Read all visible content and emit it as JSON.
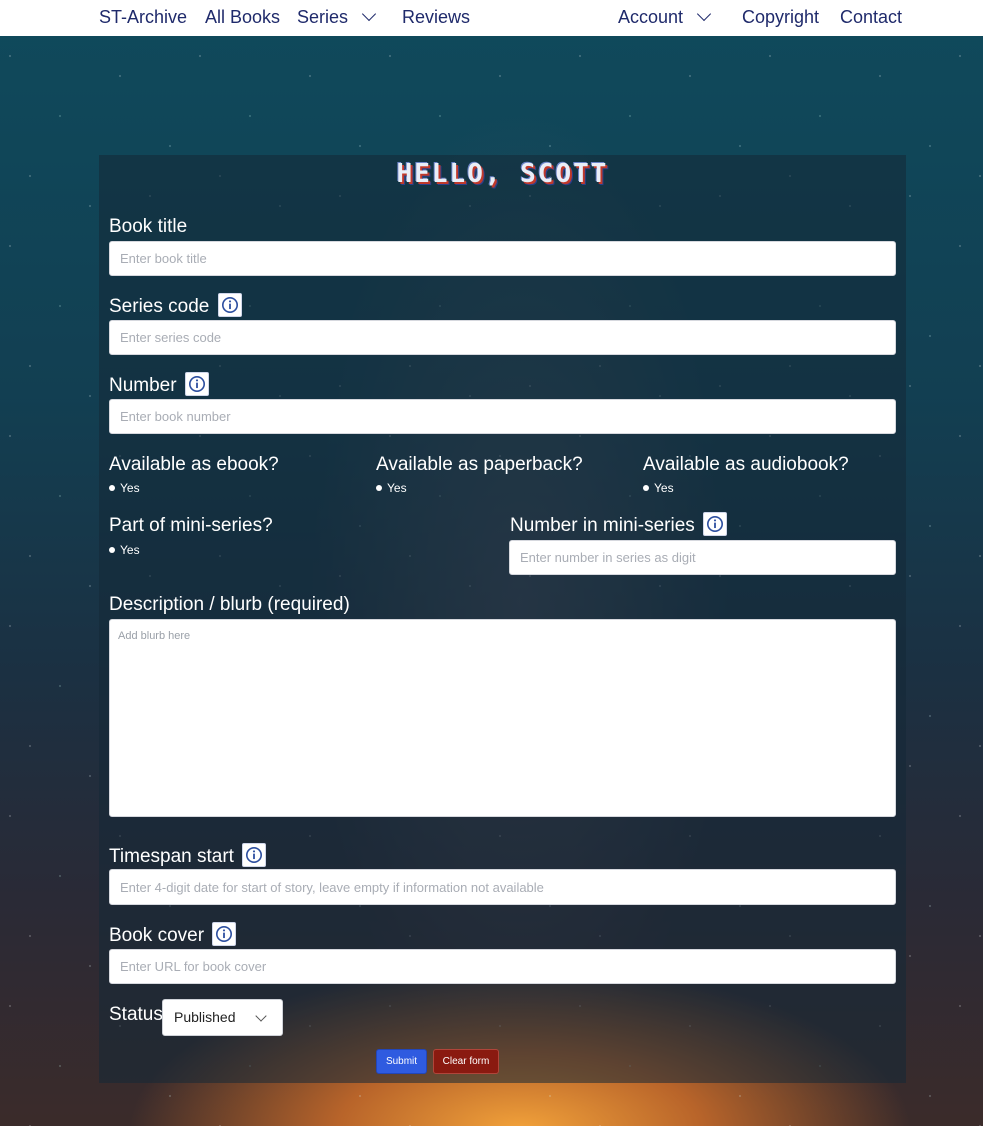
{
  "nav": {
    "brand": "ST-Archive",
    "all_books": "All Books",
    "series": "Series",
    "reviews": "Reviews",
    "account": "Account",
    "copyright": "Copyright",
    "contact": "Contact"
  },
  "form": {
    "heading": "HELLO, SCOTT",
    "book_title": {
      "label": "Book title",
      "placeholder": "Enter book title"
    },
    "series_code": {
      "label": "Series code",
      "placeholder": "Enter series code"
    },
    "number": {
      "label": "Number",
      "placeholder": "Enter book number"
    },
    "ebook": {
      "label": "Available as ebook?",
      "option": "Yes"
    },
    "paperback": {
      "label": "Available as paperback?",
      "option": "Yes"
    },
    "audiobook": {
      "label": "Available as audiobook?",
      "option": "Yes"
    },
    "mini_series": {
      "label": "Part of mini-series?",
      "option": "Yes"
    },
    "mini_series_number": {
      "label": "Number in mini-series",
      "placeholder": "Enter number in series as digit"
    },
    "description": {
      "label": "Description / blurb (required)",
      "placeholder": "Add blurb here"
    },
    "timespan": {
      "label": "Timespan start",
      "placeholder": "Enter 4-digit date for start of story, leave empty if information not available"
    },
    "cover": {
      "label": "Book cover",
      "placeholder": "Enter URL for book cover"
    },
    "status": {
      "label": "Status",
      "value": "Published"
    },
    "submit_label": "Submit",
    "clear_label": "Clear form"
  },
  "colors": {
    "nav_text": "#1f2a6b",
    "submit": "#2f5be0",
    "clear": "#8a1a10"
  }
}
